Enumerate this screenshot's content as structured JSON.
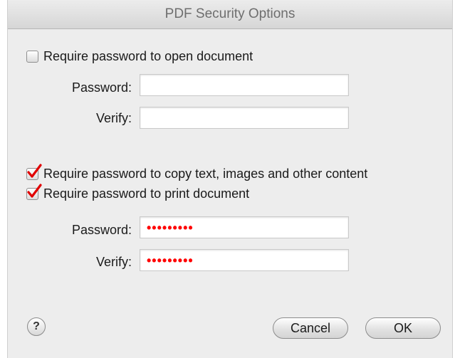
{
  "window": {
    "title": "PDF Security Options"
  },
  "open_section": {
    "checkbox_label": "Require password to open document",
    "checked": false,
    "password_label": "Password:",
    "password_value": "",
    "verify_label": "Verify:",
    "verify_value": ""
  },
  "permissions_section": {
    "copy_checkbox_label": "Require password to copy text, images and other content",
    "copy_checked": true,
    "print_checkbox_label": "Require password to print document",
    "print_checked": true,
    "password_label": "Password:",
    "password_value": "•••••••••",
    "verify_label": "Verify:",
    "verify_value": "•••••••••"
  },
  "footer": {
    "help_label": "?",
    "cancel_label": "Cancel",
    "ok_label": "OK"
  },
  "colors": {
    "checkmark": "#e00000",
    "masked_dots": "#ff0000"
  }
}
